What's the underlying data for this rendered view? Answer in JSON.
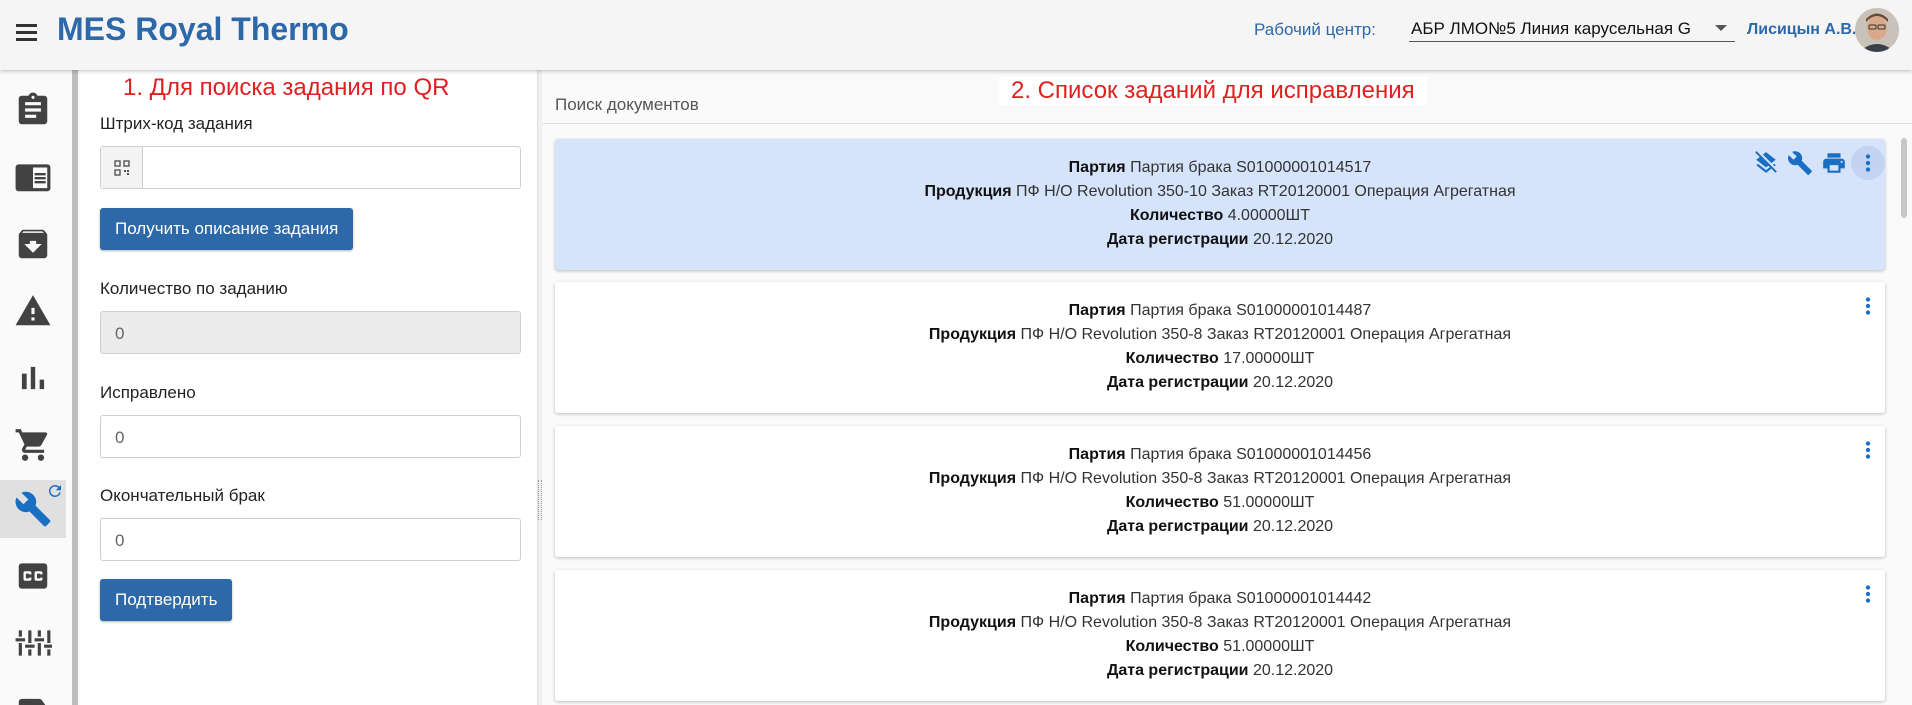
{
  "header": {
    "title": "MES Royal Thermo",
    "work_center_label": "Рабочий центр:",
    "work_center_value": "АБР ЛМО№5 Линия карусельная G",
    "user_name": "Лисицын А.В."
  },
  "sidebar": {
    "items": [
      {
        "name": "clipboard-icon"
      },
      {
        "name": "reader-icon"
      },
      {
        "name": "archive-icon"
      },
      {
        "name": "warning-icon"
      },
      {
        "name": "bar-chart-icon"
      },
      {
        "name": "cart-icon"
      },
      {
        "name": "wrench-icon",
        "active": true
      },
      {
        "name": "cc-icon"
      },
      {
        "name": "equalizer-icon"
      },
      {
        "name": "label-icon"
      }
    ]
  },
  "annotations": {
    "left": "1. Для поиска задания по QR",
    "right": "2. Список заданий для исправления"
  },
  "form": {
    "barcode_label": "Штрих-код задания",
    "barcode_value": "",
    "get_description_button": "Получить описание задания",
    "quantity_label": "Количество по заданию",
    "quantity_value": "0",
    "fixed_label": "Исправлено",
    "fixed_value": "0",
    "final_defect_label": "Окончательный брак",
    "final_defect_value": "0",
    "confirm_button": "Подтвердить"
  },
  "search": {
    "label": "Поиск документов"
  },
  "field_labels": {
    "batch": "Партия",
    "product": "Продукция",
    "qty": "Количество",
    "reg_date": "Дата регистрации"
  },
  "cards": [
    {
      "batch": "Партия брака S01000001014517",
      "product": "ПФ Н/О Revolution 350-10 Заказ RT20120001 Операция Агрегатная",
      "qty": "4.00000ШТ",
      "date": "20.12.2020",
      "selected": true
    },
    {
      "batch": "Партия брака S01000001014487",
      "product": "ПФ Н/О Revolution 350-8 Заказ RT20120001 Операция Агрегатная",
      "qty": "17.00000ШТ",
      "date": "20.12.2020"
    },
    {
      "batch": "Партия брака S01000001014456",
      "product": "ПФ Н/О Revolution 350-8 Заказ RT20120001 Операция Агрегатная",
      "qty": "51.00000ШТ",
      "date": "20.12.2020"
    },
    {
      "batch": "Партия брака S01000001014442",
      "product": "ПФ Н/О Revolution 350-8 Заказ RT20120001 Операция Агрегатная",
      "qty": "51.00000ШТ",
      "date": "20.12.2020"
    }
  ],
  "colors": {
    "brand": "#2d68a8",
    "annotation": "#e02020",
    "selected_card": "#d5e3fb"
  }
}
